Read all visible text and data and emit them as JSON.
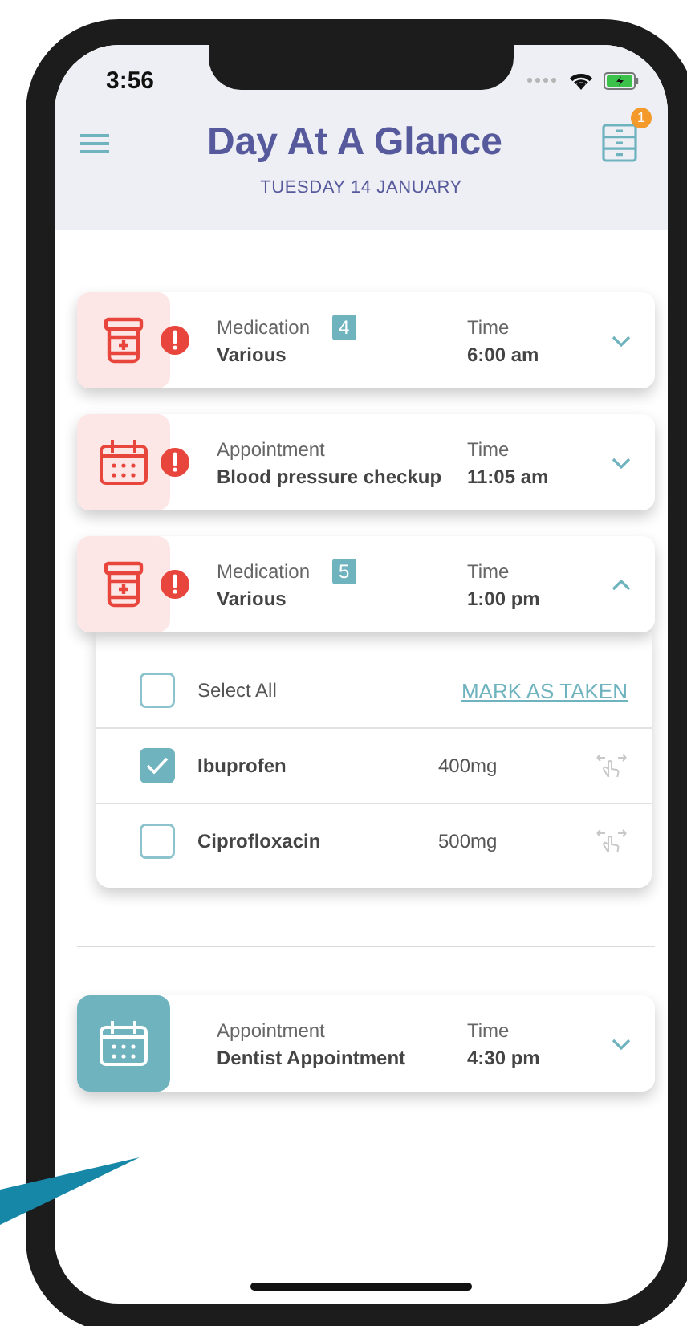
{
  "status_bar": {
    "time": "3:56"
  },
  "header": {
    "title": "Day At A Glance",
    "subtitle": "TUESDAY 14 JANUARY",
    "notification_count": "1"
  },
  "sections": [
    {
      "events": [
        {
          "kind": "medication",
          "category": "Medication",
          "count": "4",
          "name": "Various",
          "time_label": "Time",
          "time": "6:00 am",
          "alert": true,
          "expanded": false
        },
        {
          "kind": "appointment",
          "category": "Appointment",
          "name": "Blood pressure checkup",
          "time_label": "Time",
          "time": "11:05 am",
          "alert": true,
          "expanded": false
        },
        {
          "kind": "medication",
          "category": "Medication",
          "count": "5",
          "name": "Various",
          "time_label": "Time",
          "time": "1:00 pm",
          "alert": true,
          "expanded": true,
          "medications": {
            "select_all": {
              "label": "Select All",
              "checked": false
            },
            "action": "MARK AS TAKEN",
            "items": [
              {
                "name": "Ibuprofen",
                "dose": "400mg",
                "checked": true
              },
              {
                "name": "Ciprofloxacin",
                "dose": "500mg",
                "checked": false
              }
            ]
          }
        }
      ]
    },
    {
      "events": [
        {
          "kind": "appointment",
          "category": "Appointment",
          "name": "Dentist Appointment",
          "time_label": "Time",
          "time": "4:30 pm",
          "alert": false,
          "expanded": false
        }
      ]
    }
  ]
}
